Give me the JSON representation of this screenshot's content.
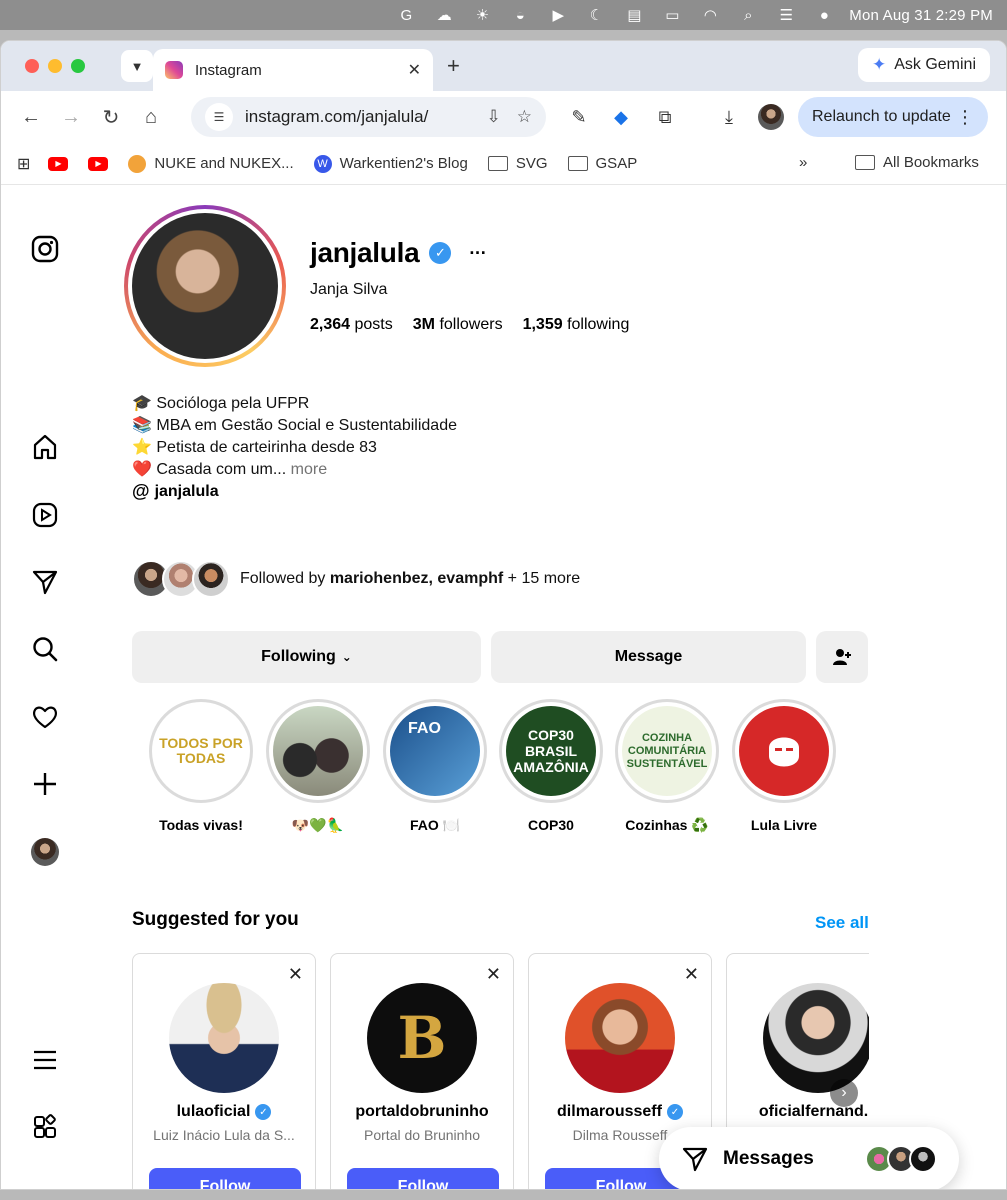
{
  "menubar": {
    "clock": "Mon Aug 31  2:29 PM",
    "icons": [
      "grammarly-icon",
      "cloud-sync-icon",
      "brightness-icon",
      "app-icon",
      "play-icon",
      "moon-icon",
      "card-icon",
      "battery-icon",
      "wifi-icon",
      "search-icon",
      "control-center-icon",
      "siri-icon"
    ]
  },
  "browser": {
    "tab_title": "Instagram",
    "ask_gemini": "Ask Gemini",
    "url": "instagram.com/janjalula/",
    "relaunch": "Relaunch to update",
    "bookmarks": [
      {
        "label": "NUKE and NUKEX...",
        "icon": "nuke-icon"
      },
      {
        "label": "Warkentien2's Blog",
        "icon": "wordpress-icon"
      },
      {
        "label": "SVG",
        "icon": "folder-icon"
      },
      {
        "label": "GSAP",
        "icon": "folder-icon"
      }
    ],
    "all_bookmarks": "All Bookmarks"
  },
  "profile": {
    "username": "janjalula",
    "full_name": "Janja Silva",
    "posts_count": "2,364",
    "posts_label": "posts",
    "followers_count": "3M",
    "followers_label": "followers",
    "following_count": "1,359",
    "following_label": "following",
    "bio_lines": [
      "🎓 Socióloga pela UFPR",
      "📚 MBA em Gestão Social e Sustentabilidade",
      "⭐️ Petista de carteirinha desde 83",
      "❤️ Casada com um..."
    ],
    "bio_more": "more",
    "threads_handle": "janjalula",
    "followed_by_prefix": "Followed by",
    "followed_by_names": "mariohenbez, evamphf",
    "followed_by_suffix": "+ 15 more"
  },
  "actions": {
    "following": "Following",
    "message": "Message"
  },
  "highlights": [
    {
      "label": "Todas vivas!",
      "cover": "TODOS POR TODAS"
    },
    {
      "label": "🐶💚🦜",
      "cover": ""
    },
    {
      "label": "FAO 🍽️",
      "cover": "FAO"
    },
    {
      "label": "COP30",
      "cover": "COP30 BRASIL AMAZÔNIA"
    },
    {
      "label": "Cozinhas ♻️",
      "cover": "COZINHA COMUNITÁRIA SUSTENTÁVEL"
    },
    {
      "label": "Lula Livre",
      "cover": ""
    }
  ],
  "suggested": {
    "heading": "Suggested for you",
    "see_all": "See all",
    "follow_label": "Follow",
    "cards": [
      {
        "username": "lulaoficial",
        "subtitle": "Luiz Inácio Lula da S...",
        "verified": true
      },
      {
        "username": "portaldobruninho",
        "subtitle": "Portal do Bruninho",
        "verified": false
      },
      {
        "username": "dilmarousseff",
        "subtitle": "Dilma Rousseff",
        "verified": true
      },
      {
        "username": "oficialfernand...",
        "subtitle": "",
        "verified": false
      }
    ]
  },
  "messages": {
    "label": "Messages"
  },
  "colors": {
    "link_blue": "#0095f6",
    "follow_button": "#4a5df9",
    "verified": "#3897f0"
  }
}
